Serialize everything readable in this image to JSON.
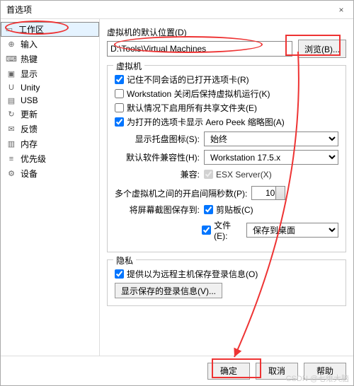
{
  "window": {
    "title": "首选项",
    "close_icon": "×"
  },
  "sidebar": {
    "items": [
      {
        "icon": "▭",
        "label": "工作区"
      },
      {
        "icon": "⊕",
        "label": "输入"
      },
      {
        "icon": "⌨",
        "label": "热键"
      },
      {
        "icon": "▣",
        "label": "显示"
      },
      {
        "icon": "U",
        "label": "Unity"
      },
      {
        "icon": "▤",
        "label": "USB"
      },
      {
        "icon": "↻",
        "label": "更新"
      },
      {
        "icon": "✉",
        "label": "反馈"
      },
      {
        "icon": "▥",
        "label": "内存"
      },
      {
        "icon": "≡",
        "label": "优先级"
      },
      {
        "icon": "⚙",
        "label": "设备"
      }
    ]
  },
  "default_location": {
    "label": "虚拟机的默认位置(D)",
    "path": "D:\\Tools\\Virtual Machines",
    "browse": "浏览(B)..."
  },
  "vm_group": {
    "title": "虚拟机",
    "chk_remember": "记住不同会话的已打开选项卡(R)",
    "chk_keeprun": "Workstation 关闭后保持虚拟机运行(K)",
    "chk_shared": "默认情况下启用所有共享文件夹(E)",
    "chk_aeropeek": "为打开的选项卡显示 Aero Peek 缩略图(A)",
    "tray_label": "显示托盘图标(S):",
    "tray_value": "始终",
    "compat_label": "默认软件兼容性(H):",
    "compat_value": "Workstation 17.5.x",
    "compat_row_label": "兼容:",
    "esx": "ESX Server(X)",
    "delay_label": "多个虚拟机之间的开启间隔秒数(P):",
    "delay_value": "10",
    "screenshot_label": "将屏幕截图保存到:",
    "clipboard": "剪贴板(C)",
    "file_label": "文件(E):",
    "file_value": "保存到桌面"
  },
  "privacy_group": {
    "title": "隐私",
    "chk_remote": "提供以为远程主机保存登录信息(O)",
    "show_saved": "显示保存的登录信息(V)..."
  },
  "footer": {
    "ok": "确定",
    "cancel": "取消",
    "help": "帮助"
  },
  "watermark": "CSDN @七维大脑"
}
